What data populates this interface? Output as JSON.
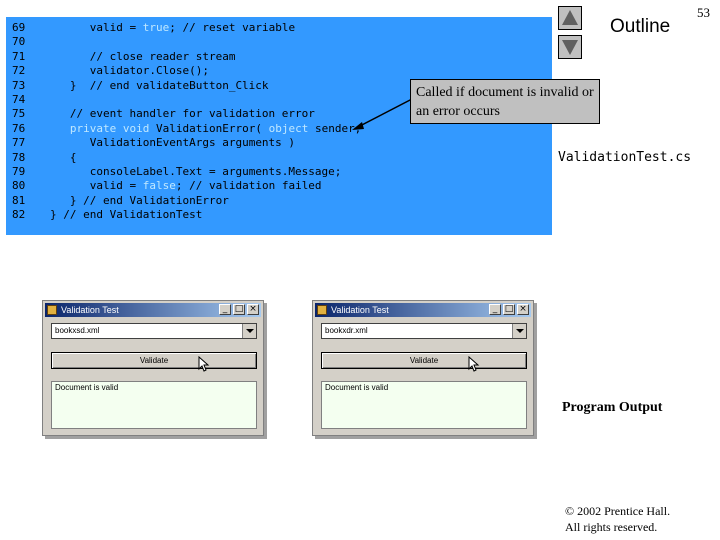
{
  "header": {
    "outline_label": "Outline",
    "slide_number": "53"
  },
  "code": {
    "lines": [
      {
        "num": "69",
        "indent": "      ",
        "tokens": [
          {
            "t": "valid = "
          },
          {
            "t": "true",
            "kw": true
          },
          {
            "t": "; // reset variable"
          }
        ]
      },
      {
        "num": "70",
        "indent": "",
        "tokens": []
      },
      {
        "num": "71",
        "indent": "      ",
        "tokens": [
          {
            "t": "// close reader stream"
          }
        ]
      },
      {
        "num": "72",
        "indent": "      ",
        "tokens": [
          {
            "t": "validator.Close();"
          }
        ]
      },
      {
        "num": "73",
        "indent": "   ",
        "tokens": [
          {
            "t": "}  // end validateButton_Click"
          }
        ]
      },
      {
        "num": "74",
        "indent": "",
        "tokens": []
      },
      {
        "num": "75",
        "indent": "   ",
        "tokens": [
          {
            "t": "// event handler for validation error"
          }
        ]
      },
      {
        "num": "76",
        "indent": "   ",
        "tokens": [
          {
            "t": "private void",
            "kw": true
          },
          {
            "t": " ValidationError( "
          },
          {
            "t": "object",
            "kw": true
          },
          {
            "t": " sender,"
          }
        ]
      },
      {
        "num": "77",
        "indent": "      ",
        "tokens": [
          {
            "t": "ValidationEventArgs arguments )"
          }
        ]
      },
      {
        "num": "78",
        "indent": "   ",
        "tokens": [
          {
            "t": "{"
          }
        ]
      },
      {
        "num": "79",
        "indent": "      ",
        "tokens": [
          {
            "t": "consoleLabel.Text = arguments.Message;"
          }
        ]
      },
      {
        "num": "80",
        "indent": "      ",
        "tokens": [
          {
            "t": "valid = "
          },
          {
            "t": "false",
            "kw": true
          },
          {
            "t": "; // validation failed"
          }
        ]
      },
      {
        "num": "81",
        "indent": "   ",
        "tokens": [
          {
            "t": "} // end ValidationError"
          }
        ]
      },
      {
        "num": "82",
        "indent": "",
        "tokens": [
          {
            "t": "} // end ValidationTest"
          }
        ]
      }
    ]
  },
  "callout": {
    "text": "Called if document is invalid or an error occurs"
  },
  "sidebar": {
    "file_title": "ValidationTest.cs",
    "program_output": "Program Output",
    "copyright_line1": "© 2002 Prentice Hall.",
    "copyright_line2": "All rights reserved."
  },
  "windows": [
    {
      "title": "Validation Test",
      "combo_value": "bookxsd.xml",
      "button_label": "Validate",
      "result_text": "Document is valid",
      "ctrl_min": "_",
      "ctrl_max": "□",
      "ctrl_close": "×"
    },
    {
      "title": "Validation Test",
      "combo_value": "bookxdr.xml",
      "button_label": "Validate",
      "result_text": "Document is valid",
      "ctrl_min": "_",
      "ctrl_max": "□",
      "ctrl_close": "×"
    }
  ],
  "colors": {
    "code_background": "#3399ff",
    "keyword": "#c0e8ff",
    "callout_background": "#c0c0c0"
  }
}
